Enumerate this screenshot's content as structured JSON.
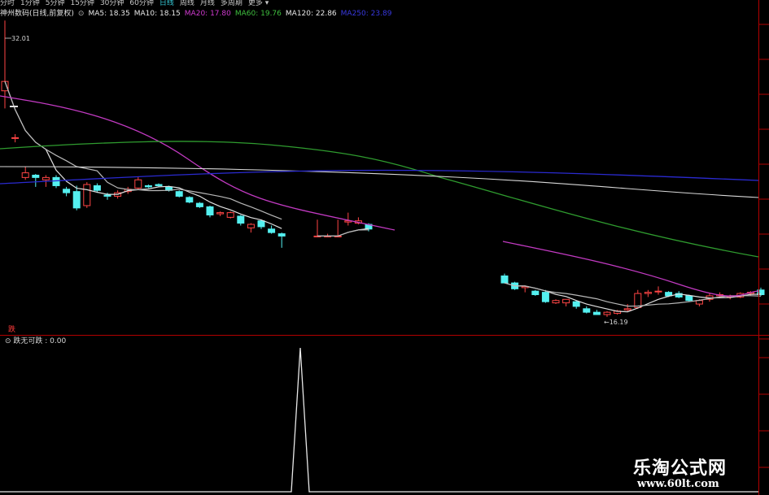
{
  "period_tabs": [
    {
      "label": "分时",
      "active": false
    },
    {
      "label": "1分钟",
      "active": false
    },
    {
      "label": "5分钟",
      "active": false
    },
    {
      "label": "15分钟",
      "active": false
    },
    {
      "label": "30分钟",
      "active": false
    },
    {
      "label": "60分钟",
      "active": false
    },
    {
      "label": "日线",
      "active": true
    },
    {
      "label": "周线",
      "active": false
    },
    {
      "label": "月线",
      "active": false
    },
    {
      "label": "多周期",
      "active": false
    },
    {
      "label": "更多 ▾",
      "active": false
    }
  ],
  "main_legend": {
    "title": "神州数码(日线,前复权)",
    "items": [
      {
        "text": "MA5: 18.35",
        "color": "#e8e8e8"
      },
      {
        "text": "MA10: 18.15",
        "color": "#e8e8e8"
      },
      {
        "text": "MA20: 17.80",
        "color": "#d03ad0"
      },
      {
        "text": "MA60: 19.76",
        "color": "#3fbf3f"
      },
      {
        "text": "MA120: 22.86",
        "color": "#e8e8e8"
      },
      {
        "text": "MA250: 23.89",
        "color": "#3838e0"
      }
    ]
  },
  "price_annotations": {
    "high": "32.01",
    "low": "←16.19"
  },
  "signal_label": "跌",
  "indicator_legend": "跌无可跌 : 0.00",
  "watermark": {
    "name": "乐淘公式网",
    "url": "www.60lt.com"
  },
  "colors": {
    "up": "#ff4545",
    "down": "#54f0f0",
    "grid": "#b20000",
    "ma5": "#e0e0e0",
    "ma10": "#b8b8b8",
    "ma20": "#c23ac2",
    "ma60": "#2f9c2f",
    "ma120": "#d8d8d8",
    "ma250": "#2a2ad0"
  },
  "chart_data": {
    "type": "candlestick",
    "segments": [
      {
        "candles": [
          {
            "o": 26.0,
            "h": 32.0,
            "l": 24.5,
            "c": 26.8
          },
          {
            "o": 22.0,
            "h": 22.3,
            "l": 21.6,
            "c": 22.0
          },
          {
            "o": 18.6,
            "h": 19.5,
            "l": 18.4,
            "c": 19.0
          },
          {
            "o": 18.8,
            "h": 18.9,
            "l": 17.8,
            "c": 18.6
          },
          {
            "o": 18.4,
            "h": 18.8,
            "l": 17.8,
            "c": 18.6
          },
          {
            "o": 18.6,
            "h": 18.8,
            "l": 17.7,
            "c": 17.9
          },
          {
            "o": 17.6,
            "h": 17.8,
            "l": 17.0,
            "c": 17.3
          },
          {
            "o": 17.4,
            "h": 17.9,
            "l": 15.8,
            "c": 16.0
          },
          {
            "o": 16.2,
            "h": 18.2,
            "l": 16.0,
            "c": 18.0
          },
          {
            "o": 17.9,
            "h": 18.1,
            "l": 17.3,
            "c": 17.5
          },
          {
            "o": 17.1,
            "h": 17.3,
            "l": 16.7,
            "c": 17.0
          },
          {
            "o": 17.0,
            "h": 17.5,
            "l": 16.8,
            "c": 17.3
          },
          {
            "o": 17.4,
            "h": 17.8,
            "l": 17.2,
            "c": 17.6
          },
          {
            "o": 17.7,
            "h": 18.7,
            "l": 17.6,
            "c": 18.4
          },
          {
            "o": 17.9,
            "h": 18.0,
            "l": 17.7,
            "c": 17.8
          },
          {
            "o": 18.0,
            "h": 18.1,
            "l": 17.8,
            "c": 17.9
          },
          {
            "o": 17.8,
            "h": 17.9,
            "l": 17.4,
            "c": 17.5
          },
          {
            "o": 17.4,
            "h": 17.5,
            "l": 16.9,
            "c": 17.0
          },
          {
            "o": 16.9,
            "h": 17.0,
            "l": 16.4,
            "c": 16.5
          },
          {
            "o": 16.4,
            "h": 16.5,
            "l": 16.0,
            "c": 16.1
          },
          {
            "o": 16.1,
            "h": 16.2,
            "l": 15.2,
            "c": 15.4
          },
          {
            "o": 15.5,
            "h": 15.7,
            "l": 15.3,
            "c": 15.6
          },
          {
            "o": 15.2,
            "h": 15.7,
            "l": 15.1,
            "c": 15.6
          },
          {
            "o": 15.3,
            "h": 15.4,
            "l": 14.5,
            "c": 14.7
          },
          {
            "o": 14.3,
            "h": 14.7,
            "l": 13.9,
            "c": 14.6
          },
          {
            "o": 14.9,
            "h": 15.0,
            "l": 14.2,
            "c": 14.4
          },
          {
            "o": 14.2,
            "h": 14.5,
            "l": 13.8,
            "c": 13.9
          },
          {
            "o": 13.8,
            "h": 13.9,
            "l": 12.6,
            "c": 13.6
          }
        ]
      },
      {
        "candles": [
          {
            "o": 13.6,
            "h": 15.0,
            "l": 13.5,
            "c": 13.6
          },
          {
            "o": 13.6,
            "h": 13.8,
            "l": 13.5,
            "c": 13.6
          },
          {
            "o": 13.6,
            "h": 15.0,
            "l": 13.5,
            "c": 13.6
          },
          {
            "o": 14.8,
            "h": 15.6,
            "l": 14.5,
            "c": 14.9
          },
          {
            "o": 14.7,
            "h": 15.2,
            "l": 14.6,
            "c": 14.9
          },
          {
            "o": 14.6,
            "h": 14.7,
            "l": 14.0,
            "c": 14.2
          }
        ]
      },
      {
        "candles": [
          {
            "o": 10.2,
            "h": 10.4,
            "l": 9.6,
            "c": 9.6
          },
          {
            "o": 9.6,
            "h": 9.7,
            "l": 9.0,
            "c": 9.1
          },
          {
            "o": 9.2,
            "h": 9.4,
            "l": 8.8,
            "c": 9.3
          },
          {
            "o": 8.9,
            "h": 9.0,
            "l": 8.5,
            "c": 8.6
          },
          {
            "o": 8.8,
            "h": 9.0,
            "l": 7.9,
            "c": 8.0
          },
          {
            "o": 7.9,
            "h": 8.2,
            "l": 7.8,
            "c": 8.1
          },
          {
            "o": 7.9,
            "h": 8.2,
            "l": 7.6,
            "c": 8.2
          },
          {
            "o": 8.0,
            "h": 8.1,
            "l": 7.4,
            "c": 7.6
          },
          {
            "o": 7.4,
            "h": 7.6,
            "l": 7.0,
            "c": 7.1
          },
          {
            "o": 7.1,
            "h": 7.3,
            "l": 6.9,
            "c": 6.9
          },
          {
            "o": 6.9,
            "h": 7.2,
            "l": 6.7,
            "c": 7.1
          },
          {
            "o": 7.0,
            "h": 7.3,
            "l": 6.9,
            "c": 7.2
          },
          {
            "o": 7.3,
            "h": 7.8,
            "l": 7.2,
            "c": 7.4
          },
          {
            "o": 7.5,
            "h": 9.0,
            "l": 7.4,
            "c": 8.7
          },
          {
            "o": 8.7,
            "h": 9.0,
            "l": 8.4,
            "c": 8.8
          },
          {
            "o": 8.9,
            "h": 9.3,
            "l": 8.6,
            "c": 8.9
          },
          {
            "o": 8.8,
            "h": 8.9,
            "l": 8.4,
            "c": 8.5
          },
          {
            "o": 8.7,
            "h": 8.9,
            "l": 8.3,
            "c": 8.4
          },
          {
            "o": 8.5,
            "h": 8.6,
            "l": 8.0,
            "c": 8.1
          },
          {
            "o": 7.8,
            "h": 8.2,
            "l": 7.6,
            "c": 8.1
          },
          {
            "o": 8.2,
            "h": 8.7,
            "l": 8.0,
            "c": 8.5
          },
          {
            "o": 8.5,
            "h": 8.8,
            "l": 8.3,
            "c": 8.6
          },
          {
            "o": 8.4,
            "h": 8.6,
            "l": 8.2,
            "c": 8.5
          },
          {
            "o": 8.4,
            "h": 8.8,
            "l": 8.3,
            "c": 8.7
          },
          {
            "o": 8.7,
            "h": 8.9,
            "l": 8.5,
            "c": 8.8
          },
          {
            "o": 9.0,
            "h": 9.2,
            "l": 8.5,
            "c": 8.6
          }
        ]
      }
    ],
    "indicator": {
      "name": "跌无可跌",
      "spike_value": 1.0,
      "value": 0.0
    }
  }
}
